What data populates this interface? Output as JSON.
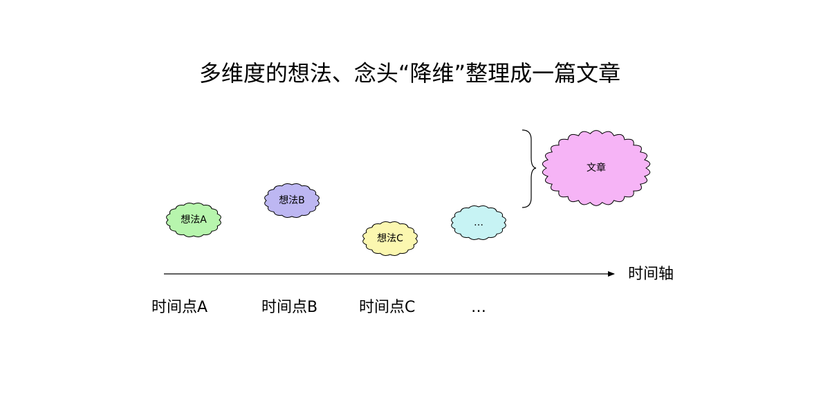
{
  "title": "多维度的想法、念头“降维”整理成一篇文章",
  "axis": {
    "label": "时间轴"
  },
  "time_points": [
    {
      "label": "时间点A"
    },
    {
      "label": "时间点B"
    },
    {
      "label": "时间点C"
    },
    {
      "label": "…"
    }
  ],
  "ideas": [
    {
      "label": "想法A",
      "fill": "#b7f5ad"
    },
    {
      "label": "想法B",
      "fill": "#bdb7f2"
    },
    {
      "label": "想法C",
      "fill": "#fbf7b0"
    },
    {
      "label": "…",
      "fill": "#c7f3f4"
    }
  ],
  "result": {
    "label": "文章",
    "fill": "#f6b4f6"
  },
  "colors": {
    "stroke": "#000000",
    "background": "#ffffff"
  }
}
